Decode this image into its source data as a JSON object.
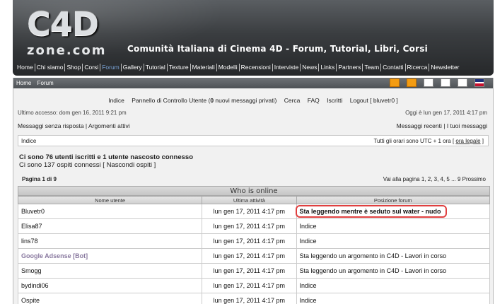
{
  "header": {
    "logo_top": "C4D",
    "logo_bottom": "zone.com",
    "tagline": "Comunità Italiana di Cinema 4D - Forum, Tutorial, Libri, Corsi",
    "nav": [
      "Home",
      "Chi siamo",
      "Shop",
      "Corsi",
      "Forum",
      "Gallery",
      "Tutorial",
      "Texture",
      "Materiali",
      "Modelli",
      "Recensioni",
      "Interviste",
      "News",
      "Links",
      "Partners",
      "Team",
      "Contatti",
      "Ricerca",
      "Newsletter"
    ],
    "active_nav": "Forum"
  },
  "breadcrumb": [
    "Home",
    "Forum"
  ],
  "user_nav": {
    "indice": "Indice",
    "pannello_prefix": "Pannello di Controllo Utente (",
    "pannello_count": "0",
    "pannello_suffix": " nuovi messaggi privati)",
    "cerca": "Cerca",
    "faq": "FAQ",
    "iscritti": "Iscritti",
    "logout": "Logout [ bluvetr0 ]"
  },
  "last_access": "Ultimo accesso: dom gen 16, 2011 9:21 pm",
  "today": "Oggi è lun gen 17, 2011 4:17 pm",
  "links": {
    "senza_risposta": "Messaggi senza risposta",
    "argomenti_attivi": "Argomenti attivi",
    "recenti": "Messaggi recenti",
    "tuoi": "I tuoi messaggi",
    "sep": "|"
  },
  "index_bar": {
    "label": "Indice",
    "timezone_prefix": "Tutti gli orari sono UTC + 1 ora [ ",
    "timezone_link": "ora legale",
    "timezone_suffix": " ]"
  },
  "online_summary": {
    "line1": "Ci sono 76 utenti iscritti e 1 utente nascosto connesso",
    "line2": "Ci sono 137 ospiti connessi [ Nascondi ospiti ]"
  },
  "pagination": {
    "label": "Pagina 1 di 9",
    "nav": "Vai alla pagina 1, 2, 3, 4, 5 ... 9  Prossimo"
  },
  "table": {
    "title": "Who is online",
    "headers": [
      "Nome utente",
      "Ultima attività",
      "Posizione forum"
    ],
    "rows": [
      {
        "user": "Bluvetr0",
        "time": "lun gen 17, 2011 4:17 pm",
        "pos": "Sta leggendo mentre è seduto sul water - nudo"
      },
      {
        "user": "Elisa87",
        "time": "lun gen 17, 2011 4:17 pm",
        "pos": "Indice"
      },
      {
        "user": "lins78",
        "time": "lun gen 17, 2011 4:17 pm",
        "pos": "Indice"
      },
      {
        "user": "Google Adsense [Bot]",
        "time": "lun gen 17, 2011 4:17 pm",
        "pos": "Sta leggendo un argomento in C4D - Lavori in corso"
      },
      {
        "user": "Smogg",
        "time": "lun gen 17, 2011 4:17 pm",
        "pos": "Sta leggendo un argomento in C4D - Lavori in corso"
      },
      {
        "user": "bydindi06",
        "time": "lun gen 17, 2011 4:17 pm",
        "pos": "Indice"
      },
      {
        "user": "Ospite",
        "time": "lun gen 17, 2011 4:17 pm",
        "pos": "Indice"
      }
    ]
  },
  "colors": {
    "header_bg": "#3a3d40",
    "highlight_border": "#e04040",
    "bot_name": "#8a7aa0",
    "nav_active": "#7aa4d8"
  }
}
